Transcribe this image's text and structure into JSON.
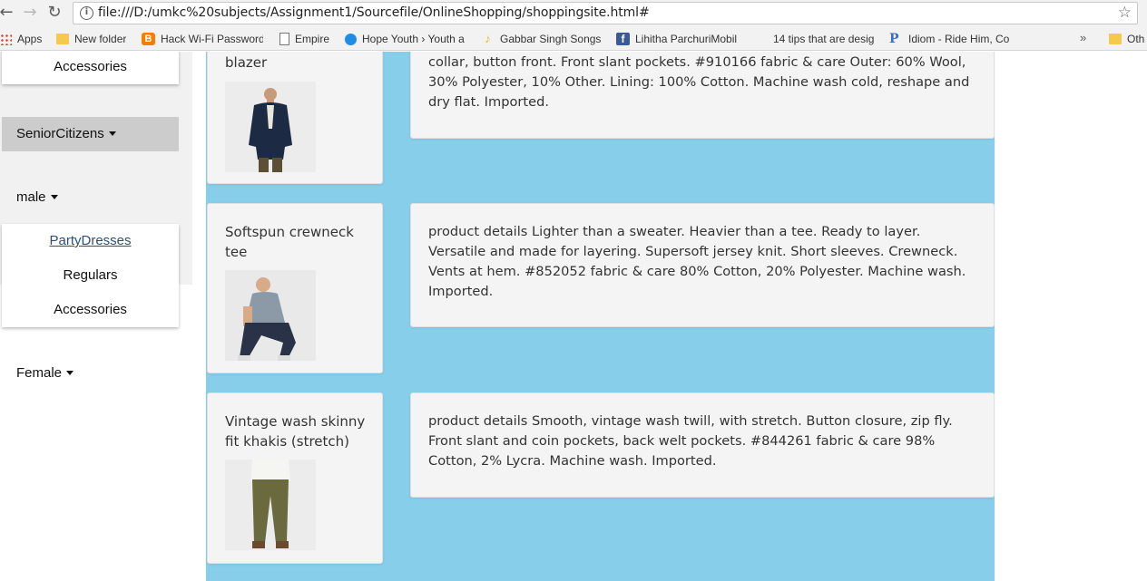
{
  "browser": {
    "url": "file:///D:/umkc%20subjects/Assignment1/Sourcefile/OnlineShopping/shoppingsite.html#",
    "bookmarks": [
      {
        "label": "Apps",
        "icon": "apps-icon"
      },
      {
        "label": "New folder",
        "icon": "folder-icon"
      },
      {
        "label": "Hack Wi-Fi Password",
        "icon": "blogger-icon"
      },
      {
        "label": "Empire",
        "icon": "page-icon"
      },
      {
        "label": "Hope Youth › Youth a",
        "icon": "shazam-icon"
      },
      {
        "label": "Gabbar Singh Songs",
        "icon": "drop-icon"
      },
      {
        "label": "Lihitha ParchuriMobil",
        "icon": "facebook-icon"
      },
      {
        "label": "14 tips that are desig",
        "icon": "blank-icon"
      },
      {
        "label": "Idiom - Ride Him, Co",
        "icon": "idiom-icon"
      },
      {
        "label": "Oth",
        "icon": "folder-icon"
      }
    ],
    "more_bookmarks": "»"
  },
  "sidebar": {
    "top_menu": {
      "items": [
        "Accessories"
      ]
    },
    "senior_citizens": "SeniorCitizens",
    "male": "male",
    "male_menu": {
      "items": [
        "PartyDresses",
        "Regulars",
        "Accessories"
      ]
    },
    "female": "Female"
  },
  "products": [
    {
      "name": "blazer",
      "description": "collar, button front. Front slant pockets. #910166 fabric & care Outer: 60% Wool, 30% Polyester, 10% Other. Lining: 100% Cotton. Machine wash cold, reshape and dry flat. Imported.",
      "image": "man-in-navy-blazer"
    },
    {
      "name": "Softspun crewneck tee",
      "description": "product details Lighter than a sweater. Heavier than a tee. Ready to layer. Versatile and made for layering. Supersoft jersey knit. Short sleeves. Crewneck. Vents at hem. #852052 fabric & care 80% Cotton, 20% Polyester. Machine wash. Imported.",
      "image": "man-in-grey-tee"
    },
    {
      "name": "Vintage wash skinny fit khakis (stretch)",
      "description": "product details Smooth, vintage wash twill, with stretch. Button closure, zip fly. Front slant and coin pockets, back welt pockets. #844261 fabric & care 98% Cotton, 2% Lycra. Machine wash. Imported.",
      "image": "man-in-olive-khakis"
    }
  ],
  "colors": {
    "content_background": "#87ceeb",
    "card_background": "#f4f4f4",
    "active_category": "#cccccc",
    "link": "#2c4f77"
  }
}
